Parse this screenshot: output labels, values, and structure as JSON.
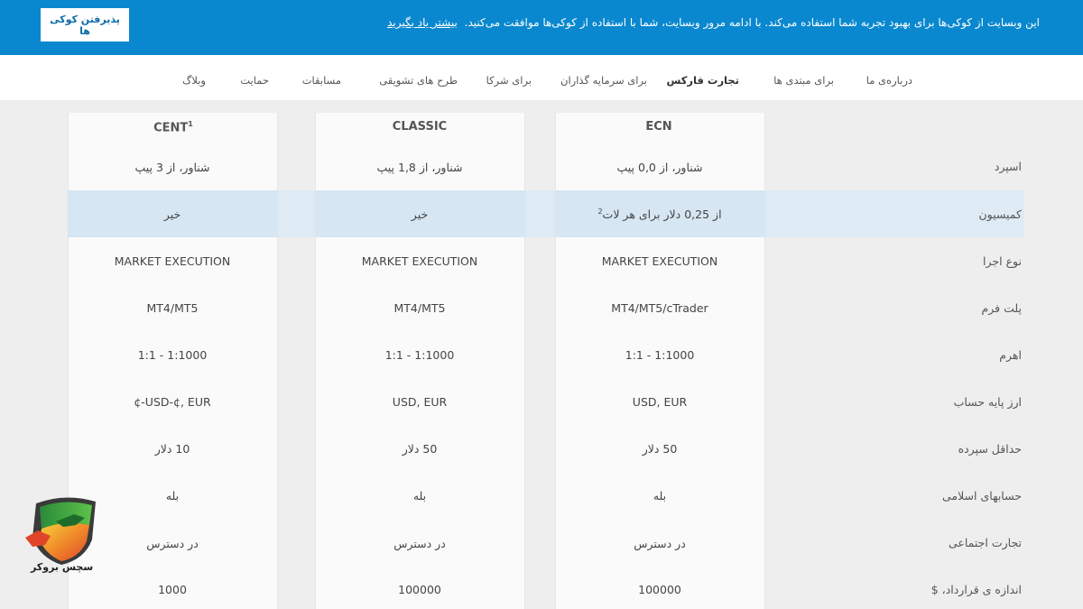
{
  "cookie": {
    "message": "این وبسایت از کوکی‌ها برای بهبود تجربه شما استفاده می‌کند. با ادامه مرور وبسایت، شما با استفاده از کوکی‌ها موافقت می‌کنید.",
    "learn_more": "بیشتر یاد بگیرید",
    "accept_label": "پذیرفتن کوکی ها"
  },
  "nav": {
    "items": [
      {
        "label": "درباره‌ی ما"
      },
      {
        "label": "برای مبتدی ها"
      },
      {
        "label": "تجارت فارکس",
        "active": true
      },
      {
        "label": "برای سرمایه گذاران"
      },
      {
        "label": "برای شرکا"
      },
      {
        "label": "طرح های تشویقی"
      },
      {
        "label": "مسابقات"
      },
      {
        "label": "حمایت"
      },
      {
        "label": "وبلاگ"
      }
    ]
  },
  "table": {
    "columns": [
      {
        "name": "ECN",
        "sup": ""
      },
      {
        "name": "CLASSIC",
        "sup": ""
      },
      {
        "name": "CENT",
        "sup": "1"
      }
    ],
    "rows": [
      {
        "label": "اسپرد",
        "ecn": "شناور، از 0,0 پیپ",
        "classic": "شناور، از 1,8 پیپ",
        "cent": "شناور، از 3 پیپ"
      },
      {
        "label": "کمیسیون",
        "ecn": "از 0,25 دلار برای هر لات",
        "ecn_sup": "2",
        "classic": "خیر",
        "cent": "خیر"
      },
      {
        "label": "نوع اجرا",
        "ecn": "MARKET EXECUTION",
        "classic": "MARKET EXECUTION",
        "cent": "MARKET EXECUTION"
      },
      {
        "label": "پلت فرم",
        "ecn": "MT4/MT5/cTrader",
        "classic": "MT4/MT5",
        "cent": "MT4/MT5"
      },
      {
        "label": "اهرم",
        "ecn": "1:1 - 1:1000",
        "classic": "1:1 - 1:1000",
        "cent": "1:1 - 1:1000"
      },
      {
        "label": "ارز پایه حساب",
        "ecn": "USD, EUR",
        "classic": "USD, EUR",
        "cent": "¢-USD-¢, EUR"
      },
      {
        "label": "حداقل سپرده",
        "ecn": "50 دلار",
        "classic": "50 دلار",
        "cent": "10 دلار"
      },
      {
        "label": "حسابهای اسلامی",
        "ecn": "بله",
        "classic": "بله",
        "cent": "بله"
      },
      {
        "label": "تجارت اجتماعی",
        "ecn": "در دسترس",
        "classic": "در دسترس",
        "cent": "در دسترس"
      },
      {
        "label": "اندازه ی قرارداد، $",
        "ecn": "100000",
        "classic": "100000",
        "cent": "1000"
      }
    ]
  },
  "logo": {
    "text": "سچس بروکر",
    "icon": "shield-fox-logo"
  }
}
